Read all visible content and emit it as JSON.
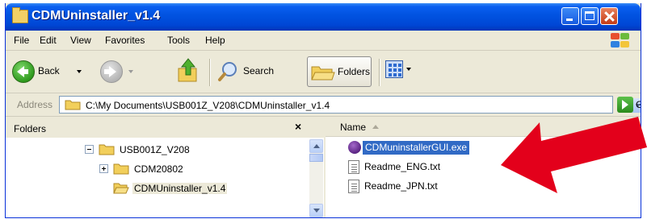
{
  "window": {
    "title": "CDMUninstaller_v1.4",
    "title_bar_color": "#0054e3"
  },
  "menubar": {
    "items": [
      "File",
      "Edit",
      "View",
      "Favorites",
      "Tools",
      "Help"
    ]
  },
  "toolbar": {
    "back_label": "Back",
    "search_label": "Search",
    "folders_label": "Folders"
  },
  "address": {
    "label": "Address",
    "path": "C:\\My Documents\\USB001Z_V208\\CDMUninstaller_v1.4",
    "go_label": "G"
  },
  "folders_pane": {
    "title": "Folders",
    "close_glyph": "×",
    "tree": [
      {
        "label": "USB001Z_V208",
        "expander": "minus"
      },
      {
        "label": "CDM20802",
        "expander": "plus"
      },
      {
        "label": "CDMUninstaller_v1.4",
        "expander": "none",
        "selected": true
      }
    ]
  },
  "file_list": {
    "column_name": "Name",
    "files": [
      {
        "name": "CDMuninstallerGUI.exe",
        "icon": "exe-icon",
        "selected": true
      },
      {
        "name": "Readme_ENG.txt",
        "icon": "txt-icon"
      },
      {
        "name": "Readme_JPN.txt",
        "icon": "txt-icon"
      }
    ]
  },
  "annotation": {
    "arrow_color": "#e3001b"
  }
}
